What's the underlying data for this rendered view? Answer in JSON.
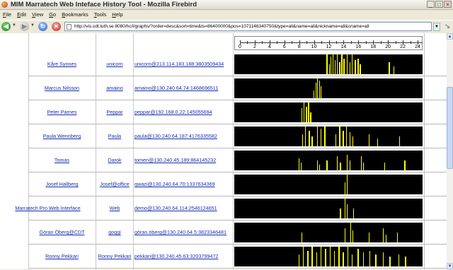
{
  "window": {
    "title": "MIM Marratech Web Inteface History Tool - Mozilla Firebird"
  },
  "menu": [
    {
      "label": "File"
    },
    {
      "label": "Edit"
    },
    {
      "label": "View"
    },
    {
      "label": "Go"
    },
    {
      "label": "Bookmarks"
    },
    {
      "label": "Tools"
    },
    {
      "label": "Help"
    }
  ],
  "navigation": {
    "url": "http://vis.cdt.luth.se:8080/hc/l/graphs/?order=desc&sort=time&ts=86400000&pos=1071146340750&type=all&name=all&nickname=all&cname=all"
  },
  "colors": {
    "activity_background": "#000000",
    "activity_bar": "#ffff00",
    "link": "#1a2fb3"
  },
  "axis": {
    "min": 0,
    "max": 24,
    "labels": [
      "0",
      "2",
      "4",
      "6",
      "8",
      "10",
      "12",
      "14",
      "16",
      "18",
      "20",
      "22",
      "24"
    ]
  },
  "rows": [
    {
      "name": "Kåre Synnes",
      "nickname": "unicorn",
      "identity": "unicorn@213.114.183.188:3803509434",
      "activity": [
        [
          11.8,
          1
        ],
        [
          12.1,
          0.5
        ],
        [
          12.3,
          0.9
        ],
        [
          12.6,
          1
        ],
        [
          12.9,
          0.7
        ],
        [
          13.2,
          1
        ],
        [
          13.5,
          0.6
        ],
        [
          13.8,
          1
        ],
        [
          14.1,
          0.8
        ],
        [
          14.5,
          1
        ],
        [
          14.9,
          0.6
        ],
        [
          15.2,
          1
        ],
        [
          15.6,
          0.7
        ],
        [
          16.0,
          0.8
        ],
        [
          16.3,
          0.5
        ],
        [
          20.2,
          0.6
        ],
        [
          20.8,
          0.4
        ]
      ]
    },
    {
      "name": "Marcus Nilsson",
      "nickname": "amaino",
      "identity": "amaino@130.240.64.74:1468696511",
      "activity": [
        [
          10.0,
          0.4
        ],
        [
          10.3,
          0.8
        ],
        [
          10.5,
          1
        ],
        [
          10.8,
          0.9
        ],
        [
          11.0,
          0.6
        ]
      ]
    },
    {
      "name": "Peter Parnes",
      "nickname": "Peppar",
      "identity": "peppar@192.168.0.22:145055694",
      "activity": [
        [
          8.4,
          0.7
        ],
        [
          8.7,
          1
        ],
        [
          9.0,
          0.8
        ],
        [
          9.3,
          1
        ],
        [
          9.6,
          0.5
        ]
      ]
    },
    {
      "name": "Paula Wennberg",
      "nickname": "Paula",
      "identity": "paula@130.240.64.187:4176335582",
      "activity": [
        [
          8.5,
          0.6
        ],
        [
          8.9,
          1
        ],
        [
          9.4,
          0.8
        ],
        [
          9.8,
          0.5
        ],
        [
          10.5,
          1
        ],
        [
          11.0,
          0.9
        ],
        [
          11.5,
          1
        ],
        [
          13.0,
          0.6
        ],
        [
          13.5,
          1
        ],
        [
          14.0,
          0.8
        ],
        [
          14.4,
          1
        ],
        [
          14.9,
          0.7
        ],
        [
          15.3,
          0.5
        ],
        [
          17.5,
          0.6
        ],
        [
          18.6,
          0.4
        ],
        [
          21.6,
          0.5
        ]
      ]
    },
    {
      "name": "Tomas",
      "nickname": "Darok",
      "identity": "tomeri@130.240.45.189:864145232",
      "activity": [
        [
          8.0,
          0.6
        ],
        [
          8.3,
          0.4
        ],
        [
          10.5,
          0.5
        ],
        [
          10.8,
          0.3
        ],
        [
          11.8,
          0.5
        ],
        [
          13.2,
          0.7
        ],
        [
          13.6,
          0.4
        ],
        [
          14.5,
          0.8
        ],
        [
          14.9,
          0.5
        ],
        [
          16.4,
          0.7
        ],
        [
          16.7,
          0.4
        ],
        [
          19.6,
          0.4
        ],
        [
          22.3,
          0.5
        ]
      ]
    },
    {
      "name": "Josef Hallberg",
      "nickname": "Josef@office",
      "identity": "qwazi@130.240.64.70:1337634369",
      "activity": [
        [
          14.2,
          0.6
        ],
        [
          14.5,
          1
        ]
      ]
    },
    {
      "name": "Marratech Pro Web Interface",
      "nickname": "Web",
      "identity": "demo@130.240.64.114:2546124651",
      "wide": true,
      "activity": [
        [
          13.6,
          0.5
        ],
        [
          14.2,
          1
        ],
        [
          14.5,
          0.7
        ],
        [
          15.4,
          0.5
        ]
      ]
    },
    {
      "name": "Göran Öberg@CDT",
      "nickname": "goggi",
      "identity": "göran.öberg@130.240.64.5:3823346481",
      "activity": [
        [
          8.4,
          0.5
        ],
        [
          14.2,
          0.7
        ],
        [
          15.0,
          1
        ],
        [
          15.3,
          0.6
        ],
        [
          17.5,
          0.5
        ],
        [
          19.4,
          0.7
        ],
        [
          19.8,
          0.4
        ],
        [
          21.3,
          0.5
        ]
      ]
    },
    {
      "name": "Ronny Pekkari",
      "nickname": "Ronny Pekkari",
      "identity": "pekkari@130.240.45.63:3203799472",
      "activity": [
        [
          8.0,
          0.6
        ],
        [
          8.6,
          1
        ],
        [
          9.2,
          0.8
        ],
        [
          9.8,
          1
        ],
        [
          10.4,
          0.7
        ],
        [
          11.0,
          1
        ],
        [
          11.6,
          0.9
        ],
        [
          12.2,
          1
        ],
        [
          12.8,
          0.8
        ],
        [
          13.4,
          1
        ],
        [
          14.0,
          0.7
        ],
        [
          14.6,
          1
        ],
        [
          15.2,
          0.6
        ],
        [
          16.0,
          0.9
        ],
        [
          16.7,
          0.7
        ],
        [
          17.6,
          0.8
        ],
        [
          18.4,
          0.6
        ],
        [
          19.4,
          0.7
        ],
        [
          20.3,
          0.5
        ],
        [
          21.5,
          0.6
        ],
        [
          22.4,
          0.5
        ]
      ]
    }
  ]
}
